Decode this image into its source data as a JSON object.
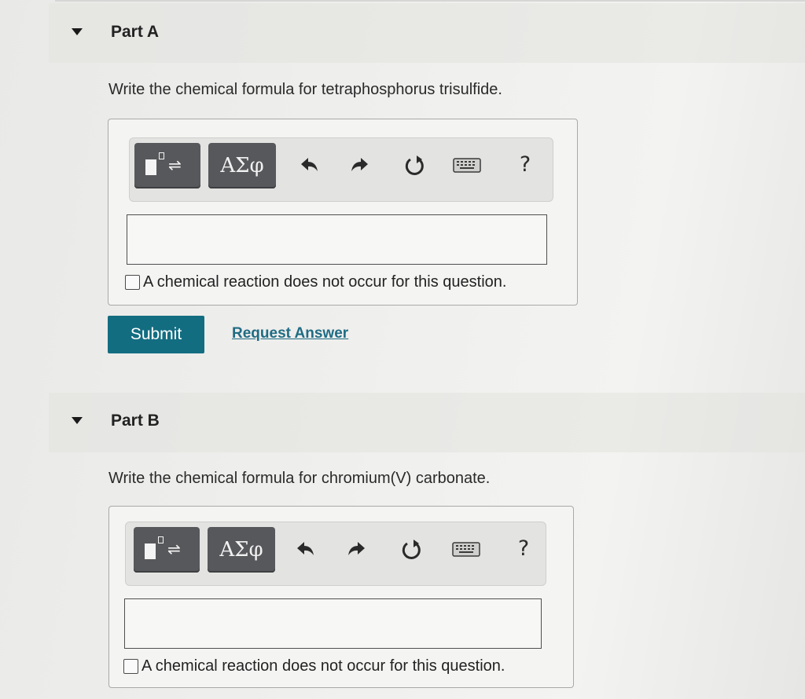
{
  "parts": [
    {
      "title": "Part A",
      "question": "Write the chemical formula for tetraphosphorus trisulfide.",
      "answer_value": "",
      "toolbar": {
        "symbols_label": "ΑΣφ",
        "help_label": "?",
        "templates_eq": "⇌",
        "icons": [
          "templates-icon",
          "undo-icon",
          "redo-icon",
          "reset-icon",
          "keyboard-icon",
          "help-icon"
        ]
      },
      "no_reaction_label": "A chemical reaction does not occur for this question.",
      "no_reaction_checked": false
    },
    {
      "title": "Part B",
      "question": "Write the chemical formula for chromium(V) carbonate.",
      "answer_value": "",
      "toolbar": {
        "symbols_label": "ΑΣφ",
        "help_label": "?",
        "templates_eq": "⇌",
        "icons": [
          "templates-icon",
          "undo-icon",
          "redo-icon",
          "reset-icon",
          "keyboard-icon",
          "help-icon"
        ]
      },
      "no_reaction_label": "A chemical reaction does not occur for this question.",
      "no_reaction_checked": false
    }
  ],
  "actions": {
    "submit_label": "Submit",
    "request_answer_label": "Request Answer"
  },
  "colors": {
    "submit_bg": "#136d81",
    "link": "#1f6c84",
    "toolbar_button": "#57585b"
  }
}
